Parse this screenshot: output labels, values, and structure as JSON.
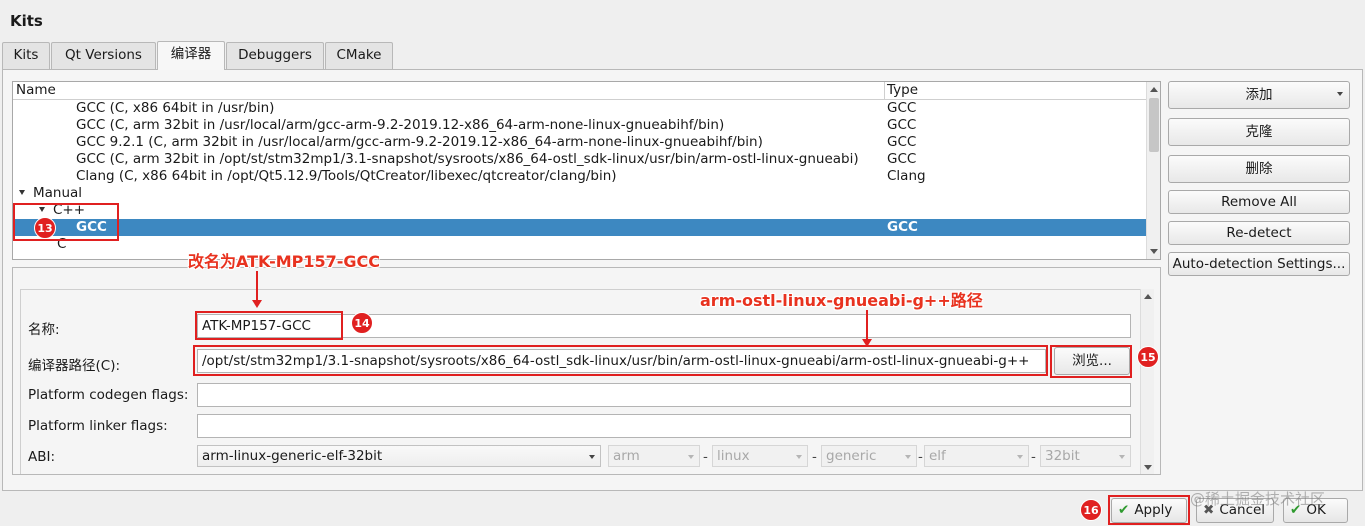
{
  "window": {
    "title": "Kits"
  },
  "tabs": [
    {
      "label": "Kits"
    },
    {
      "label": "Qt Versions"
    },
    {
      "label": "编译器"
    },
    {
      "label": "Debuggers"
    },
    {
      "label": "CMake"
    }
  ],
  "tree": {
    "columns": [
      "Name",
      "Type"
    ],
    "rows": [
      {
        "name": "GCC (C, x86 64bit in /usr/bin)",
        "type": "GCC"
      },
      {
        "name": "GCC (C, arm 32bit in /usr/local/arm/gcc-arm-9.2-2019.12-x86_64-arm-none-linux-gnueabihf/bin)",
        "type": "GCC"
      },
      {
        "name": "GCC 9.2.1 (C, arm 32bit in /usr/local/arm/gcc-arm-9.2-2019.12-x86_64-arm-none-linux-gnueabihf/bin)",
        "type": "GCC"
      },
      {
        "name": "GCC (C, arm 32bit in /opt/st/stm32mp1/3.1-snapshot/sysroots/x86_64-ostl_sdk-linux/usr/bin/arm-ostl-linux-gnueabi)",
        "type": "GCC"
      },
      {
        "name": "Clang (C, x86 64bit in /opt/Qt5.12.9/Tools/QtCreator/libexec/qtcreator/clang/bin)",
        "type": "Clang"
      },
      {
        "name": "Manual",
        "type": ""
      },
      {
        "name": "C++",
        "type": ""
      },
      {
        "name": "GCC",
        "type": "GCC"
      },
      {
        "name": "C",
        "type": ""
      }
    ]
  },
  "side_buttons": {
    "add": "添加",
    "clone": "克隆",
    "remove": "删除",
    "remove_all": "Remove All",
    "redetect": "Re-detect",
    "autodetect_settings": "Auto-detection Settings..."
  },
  "details": {
    "name_label": "名称:",
    "name_value": "ATK-MP157-GCC",
    "path_label": "编译器路径(C):",
    "path_value": "/opt/st/stm32mp1/3.1-snapshot/sysroots/x86_64-ostl_sdk-linux/usr/bin/arm-ostl-linux-gnueabi/arm-ostl-linux-gnueabi-g++",
    "browse": "浏览...",
    "codegen_label": "Platform codegen flags:",
    "codegen_value": "",
    "linker_label": "Platform linker flags:",
    "linker_value": "",
    "abi_label": "ABI:",
    "abi_main": "arm-linux-generic-elf-32bit",
    "abi_parts": [
      "arm",
      "linux",
      "generic",
      "elf",
      "32bit"
    ],
    "abi_sep": "-"
  },
  "annotations": {
    "rename_note": "改名为ATK-MP157-GCC",
    "path_note": "arm-ostl-linux-gnueabi-g++路径",
    "badges": [
      "13",
      "14",
      "15",
      "16"
    ]
  },
  "bottom_buttons": {
    "apply": "Apply",
    "cancel": "Cancel",
    "ok": "OK"
  },
  "watermark": "@稀土掘金技术社区",
  "colors": {
    "selection": "#3d88c1",
    "annotation": "#e02020"
  }
}
